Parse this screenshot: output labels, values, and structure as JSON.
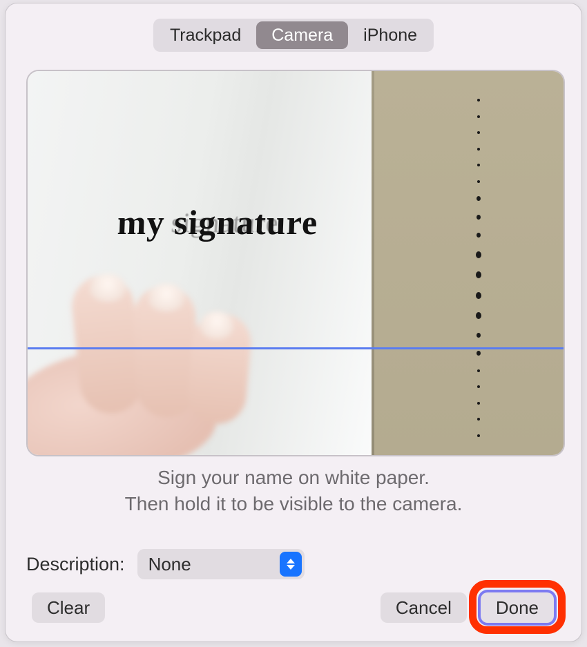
{
  "tabs": {
    "trackpad": "Trackpad",
    "camera": "Camera",
    "iphone": "iPhone",
    "active": "camera"
  },
  "preview": {
    "signature_text": "my signature",
    "ghost_text": "signature"
  },
  "instructions": {
    "line1": "Sign your name on white paper.",
    "line2": "Then hold it to be visible to the camera."
  },
  "description": {
    "label": "Description:",
    "value": "None"
  },
  "buttons": {
    "clear": "Clear",
    "cancel": "Cancel",
    "done": "Done"
  }
}
